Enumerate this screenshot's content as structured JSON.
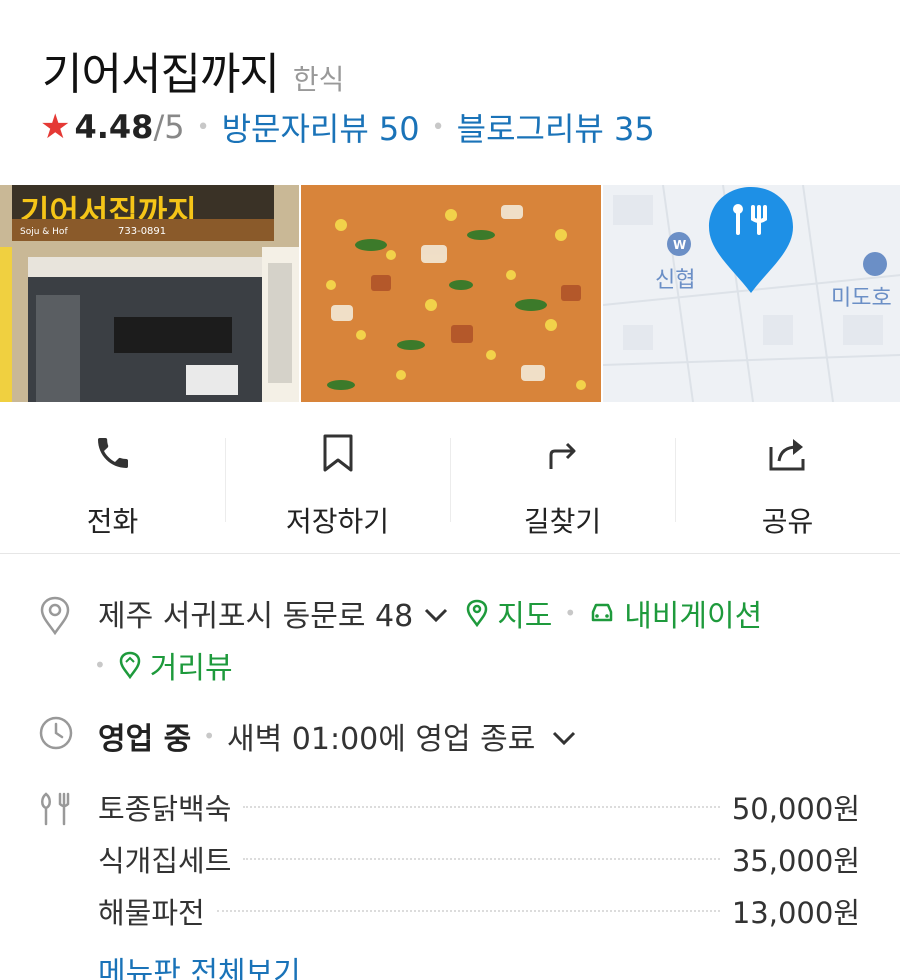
{
  "header": {
    "title": "기어서집까지",
    "category": "한식",
    "rating": "4.48",
    "rating_max": "/5",
    "visitor_reviews": "방문자리뷰 50",
    "blog_reviews": "블로그리뷰 35"
  },
  "photos": {
    "storefront_sign": "기어서집까지",
    "storefront_sub": "Soju & Hof",
    "storefront_phone": "733-0891",
    "map_labels": [
      "신협",
      "미도호"
    ]
  },
  "actions": [
    {
      "label": "전화",
      "icon": "phone-icon"
    },
    {
      "label": "저장하기",
      "icon": "bookmark-icon"
    },
    {
      "label": "길찾기",
      "icon": "directions-icon"
    },
    {
      "label": "공유",
      "icon": "share-icon"
    }
  ],
  "address": {
    "text": "제주 서귀포시 동문로 48",
    "map_link": "지도",
    "nav_link": "내비게이션",
    "street_link": "거리뷰"
  },
  "hours": {
    "status": "영업 중",
    "detail": "새벽 01:00에 영업 종료"
  },
  "menu": {
    "items": [
      {
        "name": "토종닭백숙",
        "price": "50,000원"
      },
      {
        "name": "식개집세트",
        "price": "35,000원"
      },
      {
        "name": "해물파전",
        "price": "13,000원"
      }
    ],
    "view_all": "메뉴판 전체보기"
  },
  "colors": {
    "star": "#e53935",
    "link_blue": "#1a73b8",
    "link_green": "#1e9a3c",
    "map_pin": "#1e90e6"
  }
}
